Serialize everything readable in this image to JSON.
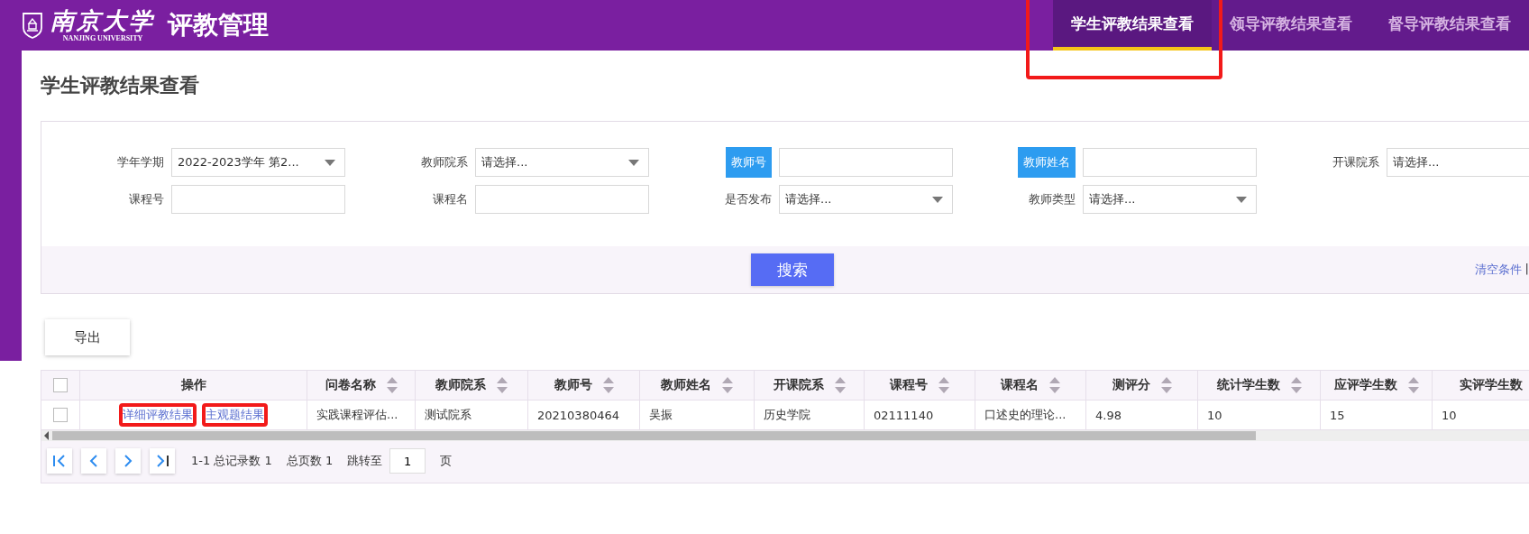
{
  "header": {
    "logo_name": "南京大学",
    "logo_subtitle": "NANJING UNIVERSITY",
    "app_title": "评教管理",
    "tabs": [
      {
        "label": "学生评教结果查看",
        "selected": true,
        "highlighted": true
      },
      {
        "label": "领导评教结果查看",
        "selected": false,
        "highlighted": false
      },
      {
        "label": "督导评教结果查看",
        "selected": false,
        "highlighted": false
      }
    ]
  },
  "page_title": "学生评教结果查看",
  "filters": [
    {
      "label": "学年学期",
      "label_tag": false,
      "kind": "select",
      "value": "2022-2023学年 第2..."
    },
    {
      "label": "教师院系",
      "label_tag": false,
      "kind": "select",
      "placeholder": "请选择..."
    },
    {
      "label": "教师号",
      "label_tag": true,
      "kind": "input"
    },
    {
      "label": "教师姓名",
      "label_tag": true,
      "kind": "input"
    },
    {
      "label": "开课院系",
      "label_tag": false,
      "kind": "select",
      "placeholder": "请选择..."
    },
    {
      "label": "课程号",
      "label_tag": false,
      "kind": "input"
    },
    {
      "label": "课程名",
      "label_tag": false,
      "kind": "input"
    },
    {
      "label": "是否发布",
      "label_tag": false,
      "kind": "select",
      "placeholder": "请选择..."
    },
    {
      "label": "教师类型",
      "label_tag": false,
      "kind": "select",
      "placeholder": "请选择..."
    }
  ],
  "search_button": "搜索",
  "clear_link": "清空条件",
  "clear_separator": "|",
  "export_button": "导出",
  "table": {
    "select_all_checked": false,
    "action_column_label": "操作",
    "columns": [
      {
        "label": "问卷名称",
        "sortable": true
      },
      {
        "label": "教师院系",
        "sortable": true
      },
      {
        "label": "教师号",
        "sortable": true
      },
      {
        "label": "教师姓名",
        "sortable": true
      },
      {
        "label": "开课院系",
        "sortable": true
      },
      {
        "label": "课程号",
        "sortable": true
      },
      {
        "label": "课程名",
        "sortable": true
      },
      {
        "label": "测评分",
        "sortable": true
      },
      {
        "label": "统计学生数",
        "sortable": true
      },
      {
        "label": "应评学生数",
        "sortable": true
      },
      {
        "label": "实评学生数",
        "sortable": false
      }
    ],
    "rows": [
      {
        "checked": false,
        "actions": [
          {
            "label": "详细评教结果",
            "highlighted": true
          },
          {
            "label": "主观题结果",
            "highlighted": true
          }
        ],
        "cells": [
          "实践课程评估...",
          "测试院系",
          "20210380464",
          "吴振",
          "历史学院",
          "02111140",
          "口述史的理论...",
          "4.98",
          "10",
          "15",
          "10"
        ]
      }
    ]
  },
  "pager": {
    "summary": "1-1 总记录数 1",
    "pages": "总页数 1",
    "jump_label": "跳转至",
    "jump_value": "1",
    "page_unit": "页"
  }
}
